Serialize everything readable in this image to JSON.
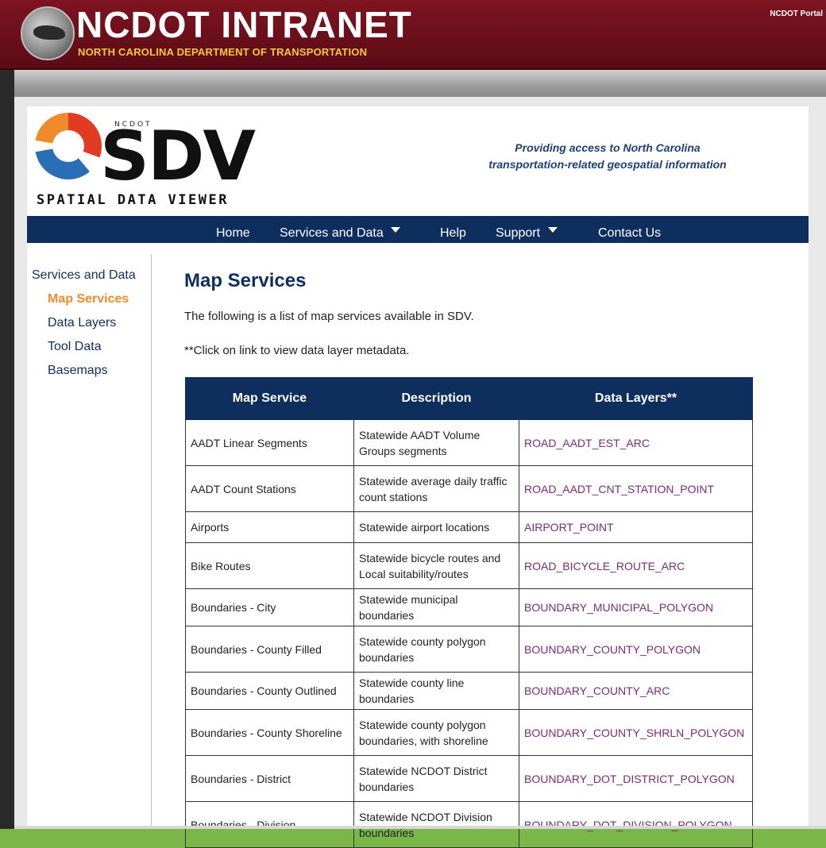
{
  "banner": {
    "title": "NCDOT INTRANET",
    "subtitle": "NORTH CAROLINA DEPARTMENT OF TRANSPORTATION",
    "portal_link": "NCDOT Portal"
  },
  "logo": {
    "ncdot": "NCDOT",
    "sdv": "SDV",
    "subtitle": "SPATIAL DATA VIEWER"
  },
  "tagline": {
    "line1": "Providing access to North Carolina",
    "line2": "transportation-related geospatial information"
  },
  "nav": {
    "home": "Home",
    "services": "Services and Data",
    "help": "Help",
    "support": "Support",
    "contact": "Contact Us"
  },
  "sidebar": {
    "heading": "Services and Data",
    "items": [
      {
        "label": "Map Services",
        "active": true
      },
      {
        "label": "Data Layers",
        "active": false
      },
      {
        "label": "Tool Data",
        "active": false
      },
      {
        "label": "Basemaps",
        "active": false
      }
    ]
  },
  "main": {
    "title": "Map Services",
    "intro": "The following is a list of map services available in SDV.",
    "note": "**Click on link to view data layer metadata."
  },
  "table": {
    "headers": [
      "Map Service",
      "Description",
      "Data Layers**"
    ],
    "rows": [
      [
        "AADT Linear Segments",
        "Statewide AADT Volume Groups segments",
        "ROAD_AADT_EST_ARC"
      ],
      [
        "AADT Count Stations",
        "Statewide average daily traffic count stations",
        "ROAD_AADT_CNT_STATION_POINT"
      ],
      [
        "Airports",
        "Statewide airport locations",
        "AIRPORT_POINT"
      ],
      [
        "Bike Routes",
        "Statewide bicycle routes and Local suitability/routes",
        "ROAD_BICYCLE_ROUTE_ARC"
      ],
      [
        "Boundaries - City",
        "Statewide municipal boundaries",
        "BOUNDARY_MUNICIPAL_POLYGON"
      ],
      [
        "Boundaries - County Filled",
        "Statewide county polygon boundaries",
        "BOUNDARY_COUNTY_POLYGON"
      ],
      [
        "Boundaries - County Outlined",
        "Statewide county line boundaries",
        "BOUNDARY_COUNTY_ARC"
      ],
      [
        "Boundaries - County Shoreline",
        "Statewide county polygon boundaries, with shoreline",
        "BOUNDARY_COUNTY_SHRLN_POLYGON"
      ],
      [
        "Boundaries - District",
        "Statewide NCDOT District boundaries",
        "BOUNDARY_DOT_DISTRICT_POLYGON"
      ],
      [
        "Boundaries - Division",
        "Statewide NCDOT Division boundaries",
        "BOUNDARY_DOT_DIVISION_POLYGON"
      ]
    ]
  },
  "colors": {
    "banner": "#7e1420",
    "nav": "#0e2f5e",
    "active": "#f08a2a",
    "link": "#7b2a7e",
    "accent_gold": "#f3c83a"
  }
}
